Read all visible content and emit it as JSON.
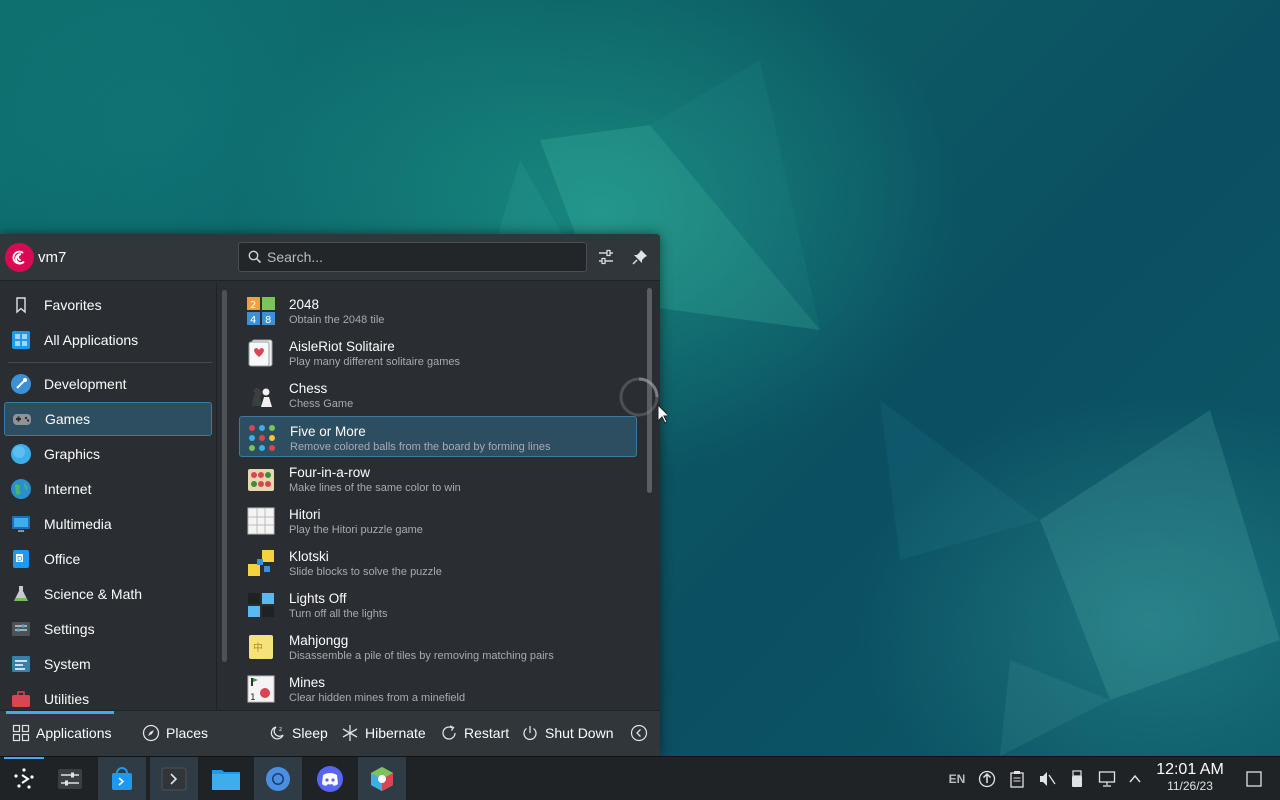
{
  "user": {
    "name": "vm7"
  },
  "search": {
    "placeholder": "Search..."
  },
  "sidebar": {
    "items": [
      {
        "label": "Favorites",
        "icon": "bookmark-icon"
      },
      {
        "label": "All Applications",
        "icon": "grid-apps-icon"
      },
      {
        "label": "Development",
        "icon": "development-icon"
      },
      {
        "label": "Games",
        "icon": "gamepad-icon",
        "selected": true
      },
      {
        "label": "Graphics",
        "icon": "graphics-icon"
      },
      {
        "label": "Internet",
        "icon": "globe-icon"
      },
      {
        "label": "Multimedia",
        "icon": "multimedia-icon"
      },
      {
        "label": "Office",
        "icon": "office-icon"
      },
      {
        "label": "Science & Math",
        "icon": "flask-icon"
      },
      {
        "label": "Settings",
        "icon": "settings-icon"
      },
      {
        "label": "System",
        "icon": "system-icon"
      },
      {
        "label": "Utilities",
        "icon": "utilities-icon"
      }
    ]
  },
  "apps": [
    {
      "name": "2048",
      "desc": "Obtain the 2048 tile",
      "icon": "game-2048-icon"
    },
    {
      "name": "AisleRiot Solitaire",
      "desc": "Play many different solitaire games",
      "icon": "solitaire-cards-icon"
    },
    {
      "name": "Chess",
      "desc": "Chess Game",
      "icon": "chess-icon"
    },
    {
      "name": "Five or More",
      "desc": "Remove colored balls from the board by forming lines",
      "icon": "five-or-more-icon",
      "selected": true
    },
    {
      "name": "Four-in-a-row",
      "desc": "Make lines of the same color to win",
      "icon": "four-in-a-row-icon"
    },
    {
      "name": "Hitori",
      "desc": "Play the Hitori puzzle game",
      "icon": "hitori-icon"
    },
    {
      "name": "Klotski",
      "desc": "Slide blocks to solve the puzzle",
      "icon": "klotski-icon"
    },
    {
      "name": "Lights Off",
      "desc": "Turn off all the lights",
      "icon": "lights-off-icon"
    },
    {
      "name": "Mahjongg",
      "desc": "Disassemble a pile of tiles by removing matching pairs",
      "icon": "mahjongg-icon"
    },
    {
      "name": "Mines",
      "desc": "Clear hidden mines from a minefield",
      "icon": "mines-icon"
    }
  ],
  "footer": {
    "applications_tab": "Applications",
    "places_tab": "Places",
    "sleep": "Sleep",
    "hibernate": "Hibernate",
    "restart": "Restart",
    "shutdown": "Shut Down"
  },
  "taskbar": {
    "language": "EN",
    "time": "12:01 AM",
    "date": "11/26/23"
  },
  "colors": {
    "accent": "#3daee9",
    "selection_bg": "#2d4d60",
    "panel_bg": "#2a2e32",
    "taskbar_bg": "#202326"
  }
}
